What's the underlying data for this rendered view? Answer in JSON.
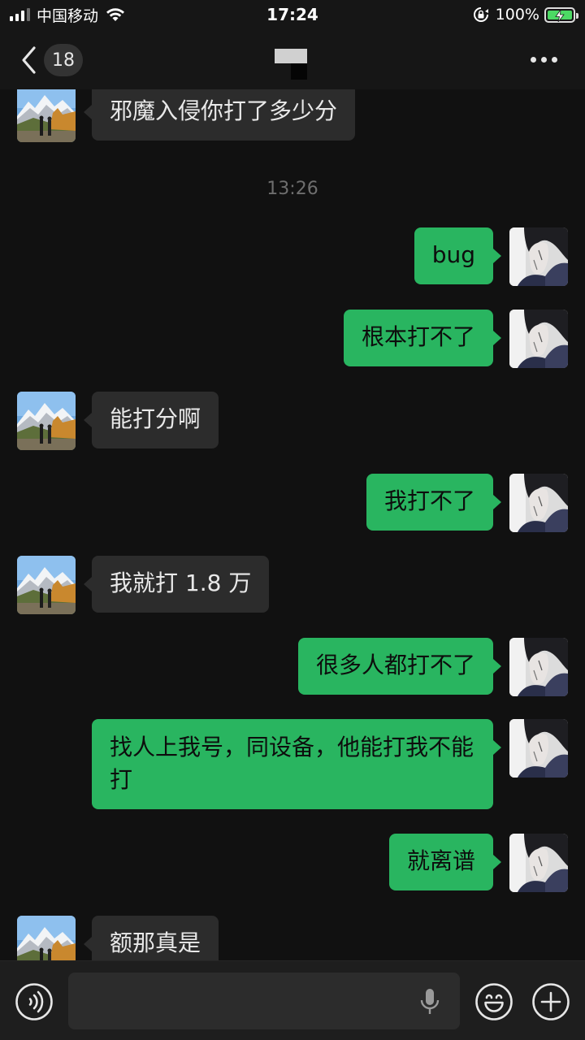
{
  "status_bar": {
    "carrier": "中国移动",
    "time": "17:24",
    "battery_percent": "100%",
    "icons": [
      "signal-icon",
      "wifi-icon",
      "rotation-lock-icon",
      "battery-charging-icon"
    ]
  },
  "nav": {
    "unread_count": "18",
    "icons": [
      "back-chevron-icon",
      "more-icon"
    ]
  },
  "messages": [
    {
      "side": "in",
      "text": "邪魔入侵你打了多少分"
    },
    {
      "type": "timestamp",
      "text": "13:26"
    },
    {
      "side": "out",
      "text": "bug"
    },
    {
      "side": "out",
      "text": "根本打不了"
    },
    {
      "side": "in",
      "text": "能打分啊"
    },
    {
      "side": "out",
      "text": "我打不了"
    },
    {
      "side": "in",
      "text": "我就打 1.8 万"
    },
    {
      "side": "out",
      "text": "很多人都打不了"
    },
    {
      "side": "out",
      "text": "找人上我号，同设备，他能打我不能打"
    },
    {
      "side": "out",
      "text": "就离谱"
    },
    {
      "side": "in",
      "text": "额那真是"
    }
  ],
  "input_bar": {
    "icons": [
      "voice-icon",
      "microphone-icon",
      "emoji-icon",
      "plus-icon"
    ]
  },
  "colors": {
    "background": "#111111",
    "outgoing_bubble": "#29b560",
    "incoming_bubble": "#2c2c2c",
    "battery": "#4cd964"
  }
}
